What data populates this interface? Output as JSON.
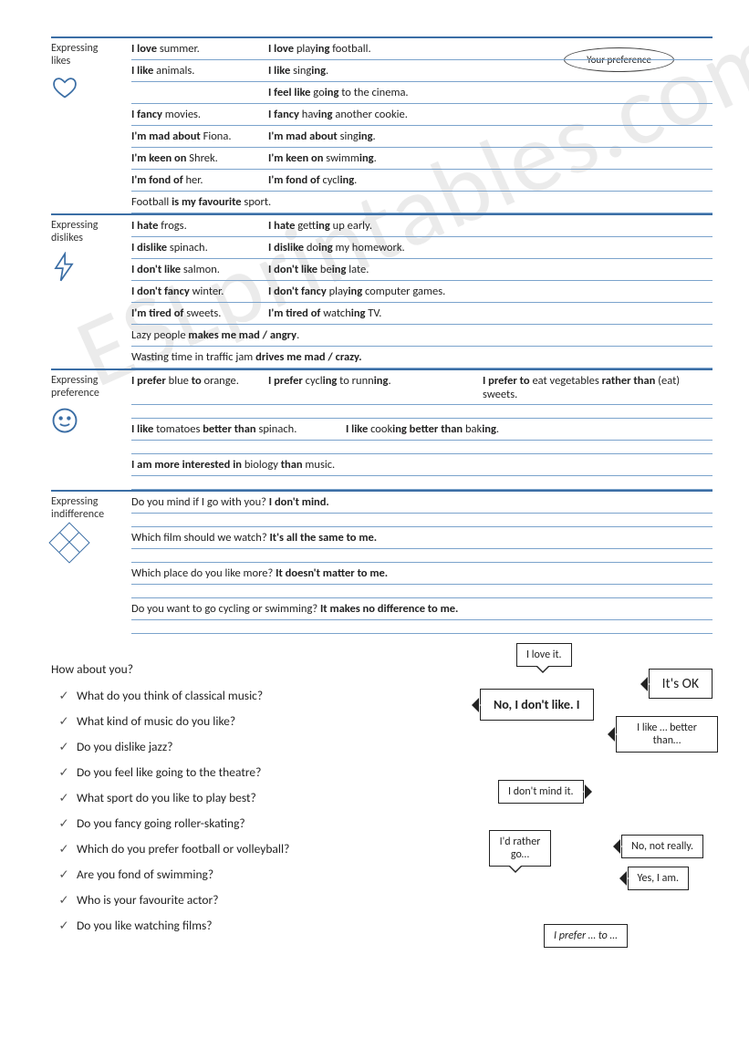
{
  "header": {
    "bubble": "Your preference"
  },
  "watermark": "ESLprintables.com",
  "sections": [
    {
      "label": "Expressing likes",
      "icon": "heart",
      "rows": [
        {
          "cells": [
            {
              "w": "w1",
              "parts": [
                {
                  "t": "I love ",
                  "b": true
                },
                {
                  "t": "summer."
                }
              ]
            },
            {
              "w": "wfull",
              "parts": [
                {
                  "t": "I love ",
                  "b": true
                },
                {
                  "t": "play"
                },
                {
                  "t": "ing",
                  "b": true
                },
                {
                  "t": " football."
                }
              ]
            }
          ]
        },
        {
          "cells": [
            {
              "w": "w1",
              "parts": [
                {
                  "t": "I like ",
                  "b": true
                },
                {
                  "t": "animals."
                }
              ]
            },
            {
              "w": "wfull",
              "parts": [
                {
                  "t": "I like ",
                  "b": true
                },
                {
                  "t": "sing"
                },
                {
                  "t": "ing",
                  "b": true
                },
                {
                  "t": "."
                }
              ]
            }
          ]
        },
        {
          "cells": [
            {
              "w": "w1",
              "parts": []
            },
            {
              "w": "wfull",
              "parts": [
                {
                  "t": "I feel like ",
                  "b": true
                },
                {
                  "t": "go"
                },
                {
                  "t": "ing",
                  "b": true
                },
                {
                  "t": " to the cinema."
                }
              ]
            }
          ]
        },
        {
          "cells": [
            {
              "w": "w1",
              "parts": [
                {
                  "t": "I fancy ",
                  "b": true
                },
                {
                  "t": "movies."
                }
              ]
            },
            {
              "w": "wfull",
              "parts": [
                {
                  "t": "I fancy ",
                  "b": true
                },
                {
                  "t": "hav"
                },
                {
                  "t": "ing",
                  "b": true
                },
                {
                  "t": " another cookie."
                }
              ]
            }
          ]
        },
        {
          "cells": [
            {
              "w": "w1",
              "parts": [
                {
                  "t": "I'm mad about ",
                  "b": true
                },
                {
                  "t": "Fiona."
                }
              ]
            },
            {
              "w": "wfull",
              "parts": [
                {
                  "t": "I'm mad about ",
                  "b": true
                },
                {
                  "t": "sing"
                },
                {
                  "t": "ing",
                  "b": true
                },
                {
                  "t": "."
                }
              ]
            }
          ]
        },
        {
          "cells": [
            {
              "w": "w1",
              "parts": [
                {
                  "t": "I'm keen on ",
                  "b": true
                },
                {
                  "t": "Shrek."
                }
              ]
            },
            {
              "w": "wfull",
              "parts": [
                {
                  "t": "I'm keen on ",
                  "b": true
                },
                {
                  "t": "swimm"
                },
                {
                  "t": "ing",
                  "b": true
                },
                {
                  "t": "."
                }
              ]
            }
          ]
        },
        {
          "cells": [
            {
              "w": "w1",
              "parts": [
                {
                  "t": "I'm fond of ",
                  "b": true
                },
                {
                  "t": "her."
                }
              ]
            },
            {
              "w": "wfull",
              "parts": [
                {
                  "t": "I'm fond of ",
                  "b": true
                },
                {
                  "t": "cycl"
                },
                {
                  "t": "ing",
                  "b": true
                },
                {
                  "t": "."
                }
              ]
            }
          ]
        },
        {
          "cells": [
            {
              "w": "wfull",
              "parts": [
                {
                  "t": "Football "
                },
                {
                  "t": "is my favourite",
                  "b": true
                },
                {
                  "t": " sport."
                }
              ]
            }
          ]
        }
      ]
    },
    {
      "label": "Expressing dislikes",
      "icon": "bolt",
      "rows": [
        {
          "cells": [
            {
              "w": "w1",
              "parts": [
                {
                  "t": "I hate ",
                  "b": true
                },
                {
                  "t": "frogs."
                }
              ]
            },
            {
              "w": "wfull",
              "parts": [
                {
                  "t": "I hate ",
                  "b": true
                },
                {
                  "t": "gett"
                },
                {
                  "t": "ing",
                  "b": true
                },
                {
                  "t": " up early."
                }
              ]
            }
          ]
        },
        {
          "cells": [
            {
              "w": "w1",
              "parts": [
                {
                  "t": "I dislike ",
                  "b": true
                },
                {
                  "t": "spinach."
                }
              ]
            },
            {
              "w": "wfull",
              "parts": [
                {
                  "t": "I dislike ",
                  "b": true
                },
                {
                  "t": "do"
                },
                {
                  "t": "ing",
                  "b": true
                },
                {
                  "t": " my homework."
                }
              ]
            }
          ]
        },
        {
          "cells": [
            {
              "w": "w1",
              "parts": [
                {
                  "t": "I don't like ",
                  "b": true
                },
                {
                  "t": "salmon."
                }
              ]
            },
            {
              "w": "wfull",
              "parts": [
                {
                  "t": "I don't like ",
                  "b": true
                },
                {
                  "t": "be"
                },
                {
                  "t": "ing",
                  "b": true
                },
                {
                  "t": " late."
                }
              ]
            }
          ]
        },
        {
          "cells": [
            {
              "w": "w1",
              "parts": [
                {
                  "t": "I don't fancy ",
                  "b": true
                },
                {
                  "t": "winter."
                }
              ]
            },
            {
              "w": "wfull",
              "parts": [
                {
                  "t": "I don't fancy ",
                  "b": true
                },
                {
                  "t": " play"
                },
                {
                  "t": "ing",
                  "b": true
                },
                {
                  "t": " computer games."
                }
              ]
            }
          ]
        },
        {
          "cells": [
            {
              "w": "w1",
              "parts": [
                {
                  "t": "I'm tired of ",
                  "b": true
                },
                {
                  "t": "sweets."
                }
              ]
            },
            {
              "w": "wfull",
              "parts": [
                {
                  "t": "I'm tired of ",
                  "b": true
                },
                {
                  "t": "watch"
                },
                {
                  "t": "ing",
                  "b": true
                },
                {
                  "t": " TV."
                }
              ]
            }
          ]
        },
        {
          "cells": [
            {
              "w": "wfull",
              "parts": [
                {
                  "t": "Lazy people "
                },
                {
                  "t": "makes me mad / angry",
                  "b": true
                },
                {
                  "t": "."
                }
              ]
            }
          ]
        },
        {
          "cells": [
            {
              "w": "wfull",
              "parts": [
                {
                  "t": "Wasting time in traffic jam "
                },
                {
                  "t": "drives me mad / crazy.",
                  "b": true
                }
              ]
            }
          ]
        }
      ]
    },
    {
      "label": "Expressing preference",
      "icon": "face",
      "rows": [
        {
          "cells": [
            {
              "w": "w1",
              "parts": [
                {
                  "t": "I prefer ",
                  "b": true
                },
                {
                  "t": "blue "
                },
                {
                  "t": "to",
                  "b": true
                },
                {
                  "t": " orange."
                }
              ]
            },
            {
              "w": "w2",
              "parts": [
                {
                  "t": "I prefer ",
                  "b": true
                },
                {
                  "t": "cycl"
                },
                {
                  "t": "ing",
                  "b": true
                },
                {
                  "t": " to runn"
                },
                {
                  "t": "ing",
                  "b": true
                },
                {
                  "t": "."
                }
              ]
            },
            {
              "w": "wfull",
              "parts": [
                {
                  "t": "I prefer to ",
                  "b": true
                },
                {
                  "t": "eat vegetables "
                },
                {
                  "t": "rather than",
                  "b": true
                },
                {
                  "t": " (eat) sweets."
                }
              ]
            }
          ]
        },
        {
          "gap": true
        },
        {
          "cells": [
            {
              "w": "w2",
              "parts": [
                {
                  "t": "I like ",
                  "b": true
                },
                {
                  "t": "tomatoes "
                },
                {
                  "t": "better than",
                  "b": true
                },
                {
                  "t": " spinach."
                }
              ]
            },
            {
              "w": "wfull",
              "parts": [
                {
                  "t": "I like ",
                  "b": true
                },
                {
                  "t": "cook"
                },
                {
                  "t": "ing better than",
                  "b": true
                },
                {
                  "t": " bak"
                },
                {
                  "t": "ing",
                  "b": true
                },
                {
                  "t": "."
                }
              ]
            }
          ]
        },
        {
          "gap": true
        },
        {
          "cells": [
            {
              "w": "wfull",
              "parts": [
                {
                  "t": "I am more interested in ",
                  "b": true
                },
                {
                  "t": "biology "
                },
                {
                  "t": "than",
                  "b": true
                },
                {
                  "t": " music."
                }
              ]
            }
          ]
        },
        {
          "gap": true
        }
      ]
    },
    {
      "label": "Expressing indifference",
      "icon": "diamond",
      "rows": [
        {
          "cells": [
            {
              "w": "wfull",
              "parts": [
                {
                  "t": "Do you mind if I go with you?      "
                },
                {
                  "t": "I don't mind.",
                  "b": true
                }
              ]
            }
          ]
        },
        {
          "gap": true
        },
        {
          "cells": [
            {
              "w": "wfull",
              "parts": [
                {
                  "t": "Which film should we watch?      "
                },
                {
                  "t": "It's all the same to me.",
                  "b": true
                }
              ]
            }
          ]
        },
        {
          "gap": true
        },
        {
          "cells": [
            {
              "w": "wfull",
              "parts": [
                {
                  "t": "Which place do you like more?      "
                },
                {
                  "t": "It doesn't matter to me.",
                  "b": true
                }
              ]
            }
          ]
        },
        {
          "gap": true
        },
        {
          "cells": [
            {
              "w": "wfull",
              "parts": [
                {
                  "t": "Do you want to go cycling or swimming?     "
                },
                {
                  "t": "It makes no difference to me.",
                  "b": true
                }
              ]
            }
          ]
        },
        {
          "gap": true
        }
      ]
    }
  ],
  "questions": {
    "title": "How about you?",
    "items": [
      "What do you think of classical music?",
      "What kind of music do you like?",
      "Do you dislike jazz?",
      "Do you feel like going to the theatre?",
      "What sport do you like to play best?",
      "Do you fancy going roller-skating?",
      "Which do you prefer football or volleyball?",
      "Are you fond of swimming?",
      "Who is your favourite actor?",
      "Do you like watching films?"
    ]
  },
  "bubbles": {
    "b1": "I love it.",
    "b2": "It's OK",
    "b3": "No, I don't like. I",
    "b4": "I like … better than…",
    "b5": "I don't mind it.",
    "b6": "I'd rather go…",
    "b7": "No, not really.",
    "b8": "Yes, I am.",
    "b9": "I prefer … to …"
  }
}
